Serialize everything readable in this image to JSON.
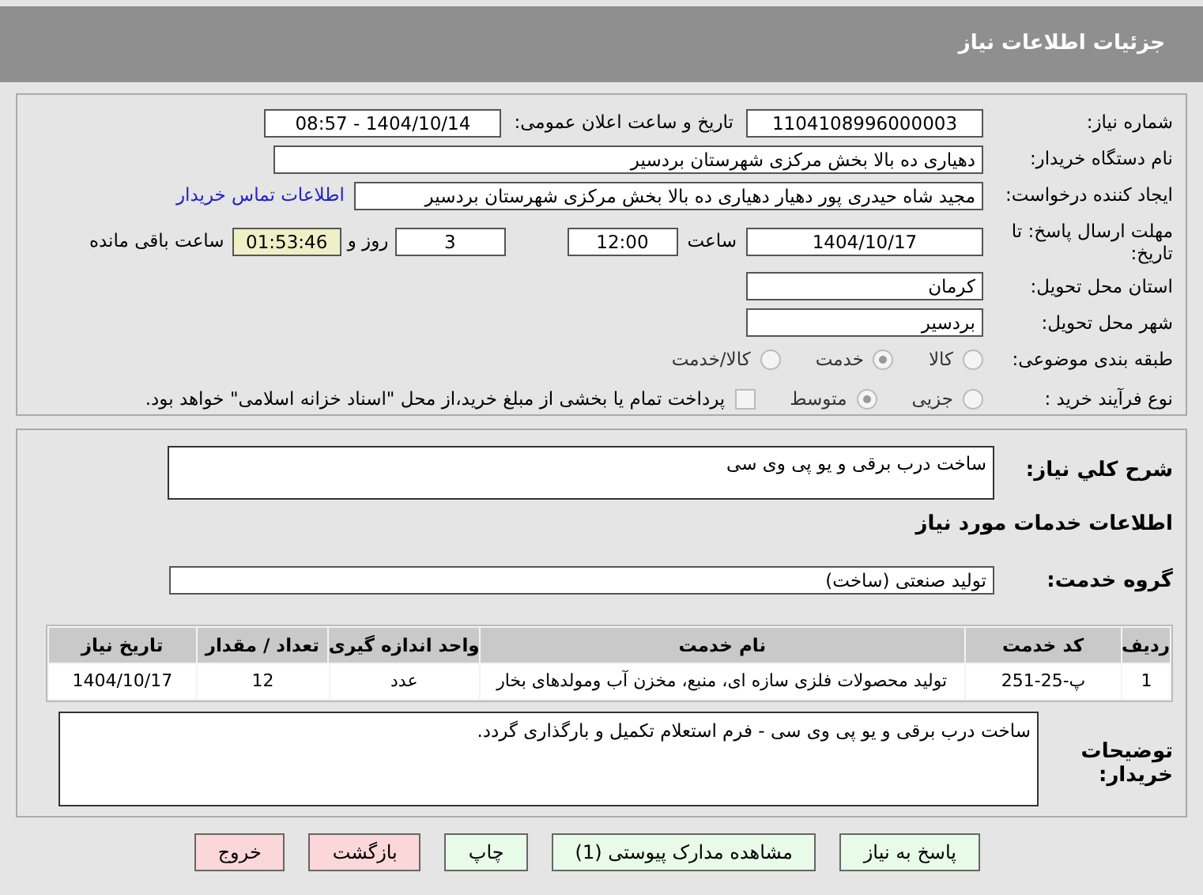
{
  "header": {
    "title": "جزئیات اطلاعات نیاز"
  },
  "need_number": {
    "label": "شماره نیاز:",
    "value": "1104108996000003"
  },
  "announce": {
    "label": "تاریخ و ساعت اعلان عمومی:",
    "value": "1404/10/14 - 08:57"
  },
  "buyer_org": {
    "label": "نام دستگاه خریدار:",
    "value": "دهیاری ده بالا بخش مرکزی شهرستان بردسیر"
  },
  "creator": {
    "label": "ایجاد کننده درخواست:",
    "value": "مجید شاه حیدری پور دهیار دهیاری ده بالا بخش مرکزی شهرستان بردسیر",
    "link": "اطلاعات تماس خریدار"
  },
  "deadline": {
    "label": "مهلت ارسال پاسخ: تا تاریخ:",
    "date": "1404/10/17",
    "time_label": "ساعت",
    "time": "12:00",
    "days": "3",
    "days_label": "روز و",
    "remaining": "01:53:46",
    "remaining_label": "ساعت باقی مانده"
  },
  "province": {
    "label": "استان محل تحویل:",
    "value": "کرمان"
  },
  "city": {
    "label": "شهر محل تحویل:",
    "value": "بردسیر"
  },
  "category": {
    "label": "طبقه بندی موضوعی:",
    "options": [
      {
        "label": "کالا",
        "selected": false
      },
      {
        "label": "خدمت",
        "selected": true
      },
      {
        "label": "کالا/خدمت",
        "selected": false
      }
    ]
  },
  "purchase_type": {
    "label": "نوع فرآیند خرید :",
    "options": [
      {
        "label": "جزیی",
        "selected": false
      },
      {
        "label": "متوسط",
        "selected": true
      }
    ],
    "payment": {
      "label": "پرداخت تمام یا بخشی از مبلغ خرید،از محل \"اسناد خزانه اسلامی\" خواهد بود.",
      "checked": false
    }
  },
  "summary": {
    "label": "شرح کلي نياز:",
    "value": "ساخت درب برقی و یو پی وی سی"
  },
  "services_title": "اطلاعات خدمات مورد نیاز",
  "service_group": {
    "label": "گروه خدمت:",
    "value": "تولید صنعتی (ساخت)"
  },
  "table": {
    "columns": [
      "ردیف",
      "کد خدمت",
      "نام خدمت",
      "واحد اندازه گیری",
      "تعداد / مقدار",
      "تاریخ نیاز"
    ],
    "rows": [
      [
        "1",
        "پ-25-251",
        "تولید محصولات فلزی سازه ای، منبع، مخزن آب ومولدهای بخار",
        "عدد",
        "12",
        "1404/10/17"
      ]
    ]
  },
  "buyer_notes": {
    "label": "توضیحات خریدار:",
    "value": "ساخت درب برقی و یو پی وی سی - فرم استعلام تکمیل و بارگذاری گردد."
  },
  "buttons": [
    {
      "label": "پاسخ به نیاز",
      "kind": "action"
    },
    {
      "label": "مشاهده مدارک پیوستی (1)",
      "kind": "action"
    },
    {
      "label": "چاپ",
      "kind": "action"
    },
    {
      "label": "بازگشت",
      "kind": "exit"
    },
    {
      "label": "خروج",
      "kind": "exit"
    }
  ]
}
